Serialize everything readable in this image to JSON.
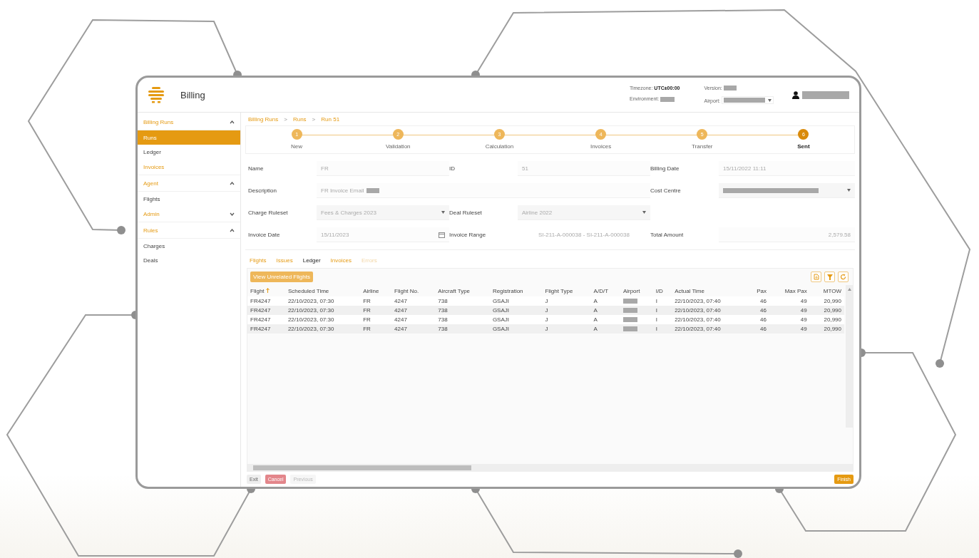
{
  "header": {
    "title": "Billing",
    "timezone_label": "Timezone:",
    "timezone": "UTC±00:00",
    "version_label": "Version:",
    "environment_label": "Environment:",
    "airport_label": "Airport:"
  },
  "sidebar": [
    {
      "label": "Billing Runs",
      "kind": "section",
      "expanded": true,
      "items": [
        {
          "label": "Runs",
          "selected": true
        },
        {
          "label": "Ledger",
          "selected": false
        }
      ]
    },
    {
      "label": "Invoices",
      "kind": "link"
    },
    {
      "label": "Agent",
      "kind": "section",
      "expanded": true,
      "items": [
        {
          "label": "Flights",
          "selected": false
        }
      ]
    },
    {
      "label": "Admin",
      "kind": "section",
      "expanded": false
    },
    {
      "label": "Rules",
      "kind": "section",
      "expanded": true,
      "items": [
        {
          "label": "Charges",
          "selected": false
        },
        {
          "label": "Deals",
          "selected": false
        }
      ]
    }
  ],
  "breadcrumb": {
    "separator": ">",
    "items": [
      "Billing Runs",
      "Runs",
      "Run 51"
    ]
  },
  "steps": [
    {
      "number": "1",
      "label": "New",
      "selected": false
    },
    {
      "number": "2",
      "label": "Validation",
      "selected": false
    },
    {
      "number": "3",
      "label": "Calculation",
      "selected": false
    },
    {
      "number": "4",
      "label": "Invoices",
      "selected": false
    },
    {
      "number": "5",
      "label": "Transfer",
      "selected": false
    },
    {
      "number": "6",
      "label": "Sent",
      "selected": true
    }
  ],
  "form": [
    [
      {
        "label": "Name",
        "kind": "text",
        "value": "FR"
      },
      {
        "label": "ID",
        "kind": "text",
        "value": "51"
      },
      {
        "label": "Billing Date",
        "kind": "text",
        "value": "15/11/2022 11:11"
      }
    ],
    [
      {
        "label": "Description",
        "kind": "wide",
        "value": "FR Invoice Email"
      },
      {
        "label": "Cost Centre",
        "kind": "select-redacted"
      }
    ],
    [
      {
        "label": "Charge Ruleset",
        "kind": "select",
        "value": "Fees & Charges 2023"
      },
      {
        "label": "Deal Ruleset",
        "kind": "select",
        "value": "Airline 2022"
      }
    ],
    [
      {
        "label": "Invoice Date",
        "kind": "date",
        "value": "15/11/2023"
      },
      {
        "label": "Invoice Range",
        "kind": "plain",
        "value": "SI-211-A-000038 - SI-211-A-000038"
      },
      {
        "label": "Total Amount",
        "kind": "amount",
        "value": "2,579.58"
      }
    ]
  ],
  "tabs": [
    {
      "label": "Flights",
      "selected": false,
      "disabled": false
    },
    {
      "label": "Issues",
      "selected": false,
      "disabled": false
    },
    {
      "label": "Ledger",
      "selected": true,
      "disabled": false
    },
    {
      "label": "Invoices",
      "selected": false,
      "disabled": false
    },
    {
      "label": "Errors",
      "selected": false,
      "disabled": true
    }
  ],
  "view_button": "View Unrelated Flights",
  "table": {
    "columns": [
      {
        "label": "Flight",
        "sorted": true,
        "kind": "text"
      },
      {
        "label": "Scheduled Time",
        "sorted": false,
        "kind": "text"
      },
      {
        "label": "Airline",
        "sorted": false,
        "kind": "text"
      },
      {
        "label": "Flight No.",
        "sorted": false,
        "kind": "text"
      },
      {
        "label": "Aircraft Type",
        "sorted": false,
        "kind": "text"
      },
      {
        "label": "Registration",
        "sorted": false,
        "kind": "text"
      },
      {
        "label": "Flight Type",
        "sorted": false,
        "kind": "text"
      },
      {
        "label": "A/D/T",
        "sorted": false,
        "kind": "text"
      },
      {
        "label": "Airport",
        "sorted": false,
        "kind": "redacted"
      },
      {
        "label": "I/D",
        "sorted": false,
        "kind": "text"
      },
      {
        "label": "Actual Time",
        "sorted": false,
        "kind": "text"
      },
      {
        "label": "Pax",
        "sorted": false,
        "kind": "number"
      },
      {
        "label": "Max Pax",
        "sorted": false,
        "kind": "number"
      },
      {
        "label": "MTOW",
        "sorted": false,
        "kind": "number"
      }
    ],
    "rows": [
      [
        "FR4247",
        "22/10/2023, 07:30",
        "FR",
        "4247",
        "738",
        "GSAJI",
        "J",
        "A",
        "",
        "I",
        "22/10/2023, 07:40",
        "46",
        "49",
        "20,990"
      ],
      [
        "FR4247",
        "22/10/2023, 07:30",
        "FR",
        "4247",
        "738",
        "GSAJI",
        "J",
        "A",
        "",
        "I",
        "22/10/2023, 07:40",
        "46",
        "49",
        "20,990"
      ],
      [
        "FR4247",
        "22/10/2023, 07:30",
        "FR",
        "4247",
        "738",
        "GSAJI",
        "J",
        "A",
        "",
        "I",
        "22/10/2023, 07:40",
        "46",
        "49",
        "20,990"
      ],
      [
        "FR4247",
        "22/10/2023, 07:30",
        "FR",
        "4247",
        "738",
        "GSAJI",
        "J",
        "A",
        "",
        "I",
        "22/10/2023, 07:40",
        "46",
        "49",
        "20,990"
      ]
    ]
  },
  "footer_buttons": [
    {
      "label": "Exit",
      "kind": "plain"
    },
    {
      "label": "Cancel",
      "kind": "danger"
    },
    {
      "label": "Previous",
      "kind": "disabled"
    },
    {
      "label": "Finish",
      "kind": "primary"
    }
  ]
}
